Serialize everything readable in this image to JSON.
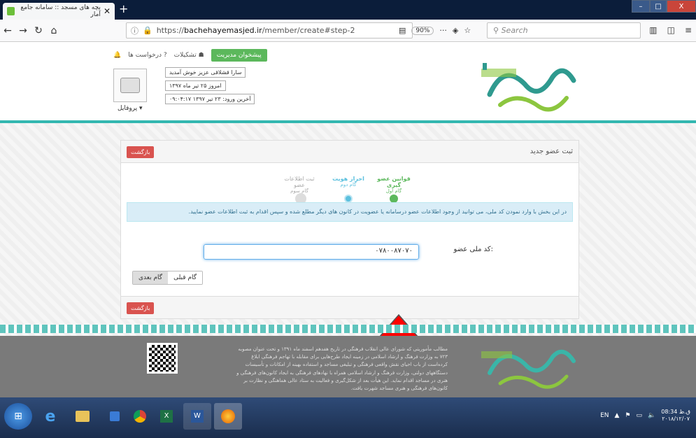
{
  "browser": {
    "tab_title": "بچه های مسجد :: سامانه جامع آمار",
    "tab_close": "✕",
    "new_tab": "+",
    "url_prefix": "https://",
    "url_host": "bachehayemasjed.ir",
    "url_path": "/member/create#step-2",
    "zoom": "90%",
    "search_placeholder": "Search",
    "window_min": "–",
    "window_max": "□",
    "window_close": "X"
  },
  "header": {
    "management_button": "پیشخوان مدیریت",
    "nav_links": [
      "تشکیلات",
      "درخواست ها"
    ],
    "greeting": "سارا قشلاقی عزیز خوش آمدید",
    "today": "امروز ۲۵ تیر ماه ۱۳۹۷",
    "last_login": "آخرین ورود: ۲۳ تیر ۱۳۹۷ ۰۹:۰۴:۱۷",
    "profile_dropdown": "پروفایل ▾"
  },
  "panel": {
    "title": "ثبت عضو جدید",
    "back_label": "بازگشت",
    "steps": [
      {
        "name": "قوانین عضو گیری",
        "sub": "گام اول",
        "color": "#5cb85c"
      },
      {
        "name": "احراز هویت",
        "sub": "گام دوم",
        "color": "#5bc0de"
      },
      {
        "name": "ثبت اطلاعات عضو",
        "sub": "گام سوم",
        "color": "#dddddd"
      }
    ],
    "alert": "در این بخش با وارد نمودن کد ملی، می توانید از وجود اطلاعات عضو درسامانه یا عضویت در کانون های دیگر مطلع شده و سپس اقدام به ثبت اطلاعات عضو نمایید.",
    "national_code_label": "کد ملی عضو:",
    "national_code_value": "۰۷۸۰۰۸۷۰۷۰",
    "prev_step": "گام قبلی",
    "next_step": "گام بعدی"
  },
  "footer": {
    "text": "مطالب مأموریتی که شورای عالی انقلاب فرهنگی در تاریخ هفدهم اسفند ماه ۱۳۹۱ و تحت عنوان مصوبه ۷۲۳ به وزارت فرهنگ و ارشاد اسلامی در زمینه ایجاد طرح‌هایی برای مقابله با تهاجم فرهنگی ابلاغ کرده‌است از باب احیای نقش واقعی فرهنگی و تبلیغی مساجد و استفاده بهینه از امکانات و تأسیسات دستگاههای دولتی، وزارت فرهنگ و ارشاد اسلامی همراه با نهادهای فرهنگی به ایجاد کانون‌های فرهنگی و هنری در مساجد اقدام نماید. این هیأت بعد از شکل‌گیری و فعالیت به ستاد عالی هماهنگی و نظارت بر کانون‌های فرهنگی و هنری مساجد شهرت یافت."
  },
  "taskbar": {
    "lang": "EN",
    "time": "08:34 ق.ظ",
    "date": "۲۰۱۸/۱۲/۰۷"
  },
  "colors": {
    "accent_teal": "#33b7b0",
    "success_green": "#5cb85c",
    "danger_red": "#d9534f",
    "info_blue": "#5bc0de"
  }
}
